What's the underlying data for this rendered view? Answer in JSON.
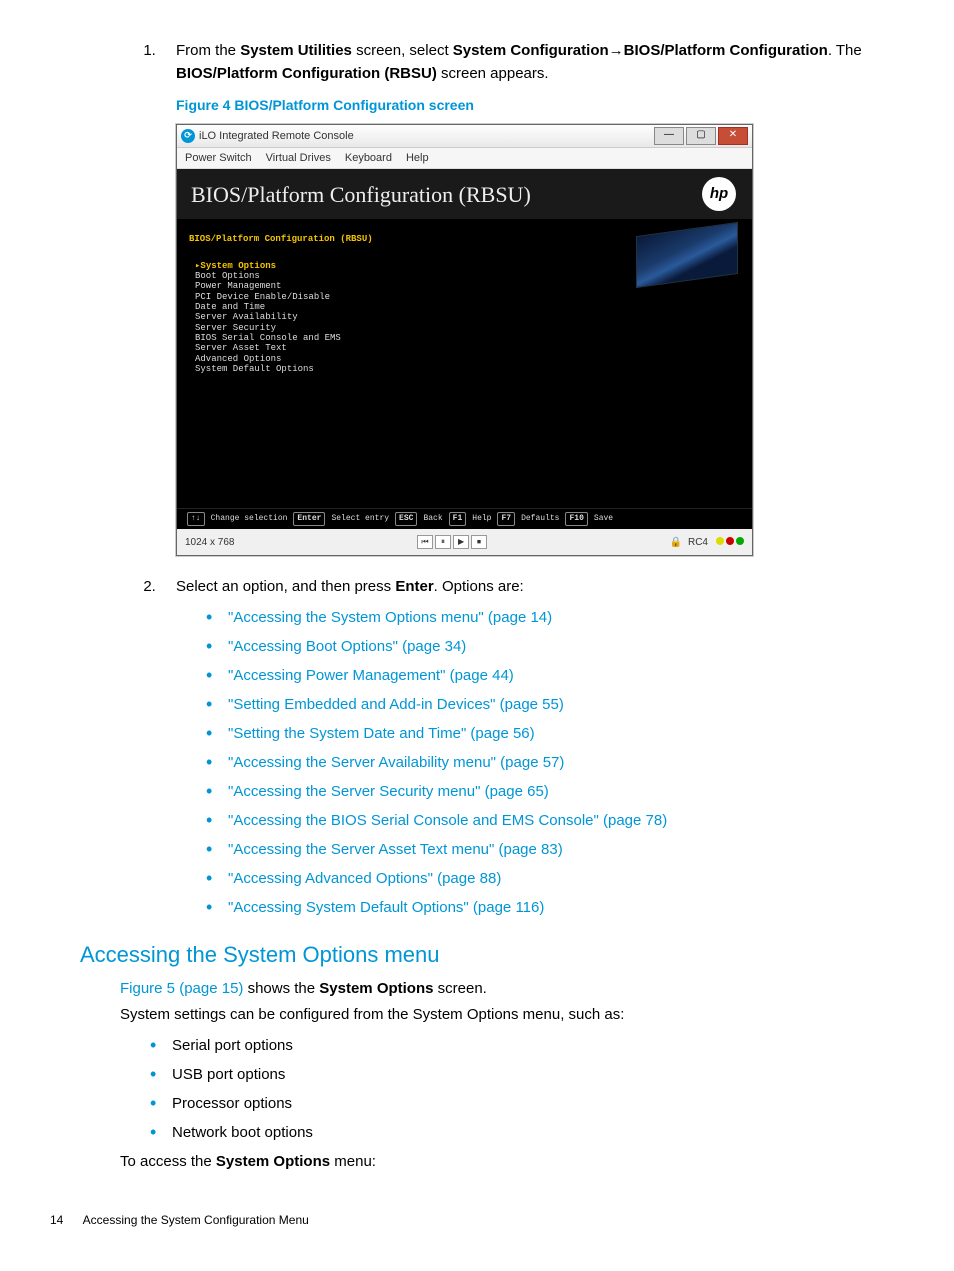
{
  "step1": {
    "prefix": "From the ",
    "sys_util": "System Utilities",
    "mid1": " screen, select ",
    "sys_conf": "System Configuration",
    "arrow": "→",
    "bios_plat": "BIOS/Platform Configuration",
    "end1": ". The ",
    "rbsu": "BIOS/Platform Configuration (RBSU)",
    "end2": " screen appears."
  },
  "figure_caption": "Figure 4 BIOS/Platform Configuration screen",
  "win": {
    "title": "iLO Integrated Remote Console",
    "menus": [
      "Power Switch",
      "Virtual Drives",
      "Keyboard",
      "Help"
    ],
    "min": "—",
    "max": "▢",
    "close": "✕",
    "bios_title": "BIOS/Platform Configuration (RBSU)",
    "hp": "hp",
    "crumb": "BIOS/Platform Configuration (RBSU)",
    "items": [
      "System Options",
      "Boot Options",
      "Power Management",
      "PCI Device Enable/Disable",
      "Date and Time",
      "Server Availability",
      "Server Security",
      "BIOS Serial Console and EMS",
      "Server Asset Text",
      "Advanced Options",
      "System Default Options"
    ],
    "keys": {
      "updown": "↑↓",
      "k1": "Change selection",
      "enter": "Enter",
      "k2": "Select entry",
      "esc": "ESC",
      "k3": "Back",
      "f1": "F1",
      "k4": "Help",
      "f7": "F7",
      "k5": "Defaults",
      "f10": "F10",
      "k6": "Save"
    },
    "status_res": "1024 x 768",
    "status_rc": "RC4",
    "media_btns": [
      "⏮",
      "⏸",
      "▶",
      "⏹"
    ]
  },
  "step2": {
    "prefix": "Select an option, and then press ",
    "enter": "Enter",
    "suffix": ". Options are:"
  },
  "links": [
    "\"Accessing the System Options menu\" (page 14)",
    "\"Accessing Boot Options\" (page 34)",
    "\"Accessing Power Management\" (page 44)",
    "\"Setting Embedded and Add-in Devices\" (page 55)",
    "\"Setting the System Date and Time\" (page 56)",
    "\"Accessing the Server Availability menu\" (page 57)",
    "\"Accessing the Server Security menu\" (page 65)",
    "\"Accessing the BIOS Serial Console and EMS Console\" (page 78)",
    "\"Accessing the Server Asset Text menu\" (page 83)",
    "\"Accessing Advanced Options\" (page 88)",
    "\"Accessing System Default Options\" (page 116)"
  ],
  "h2": "Accessing the System Options menu",
  "sysopt": {
    "fig5": "Figure 5 (page 15)",
    "mid": " shows the ",
    "bold": "System Options",
    "end": " screen."
  },
  "para2": "System settings can be configured from the System Options menu, such as:",
  "sublist": [
    "Serial port options",
    "USB port options",
    "Processor options",
    "Network boot options"
  ],
  "access": {
    "pre": "To access the ",
    "bold": "System Options",
    "post": " menu:"
  },
  "footer": {
    "page": "14",
    "title": "Accessing the System Configuration Menu"
  }
}
